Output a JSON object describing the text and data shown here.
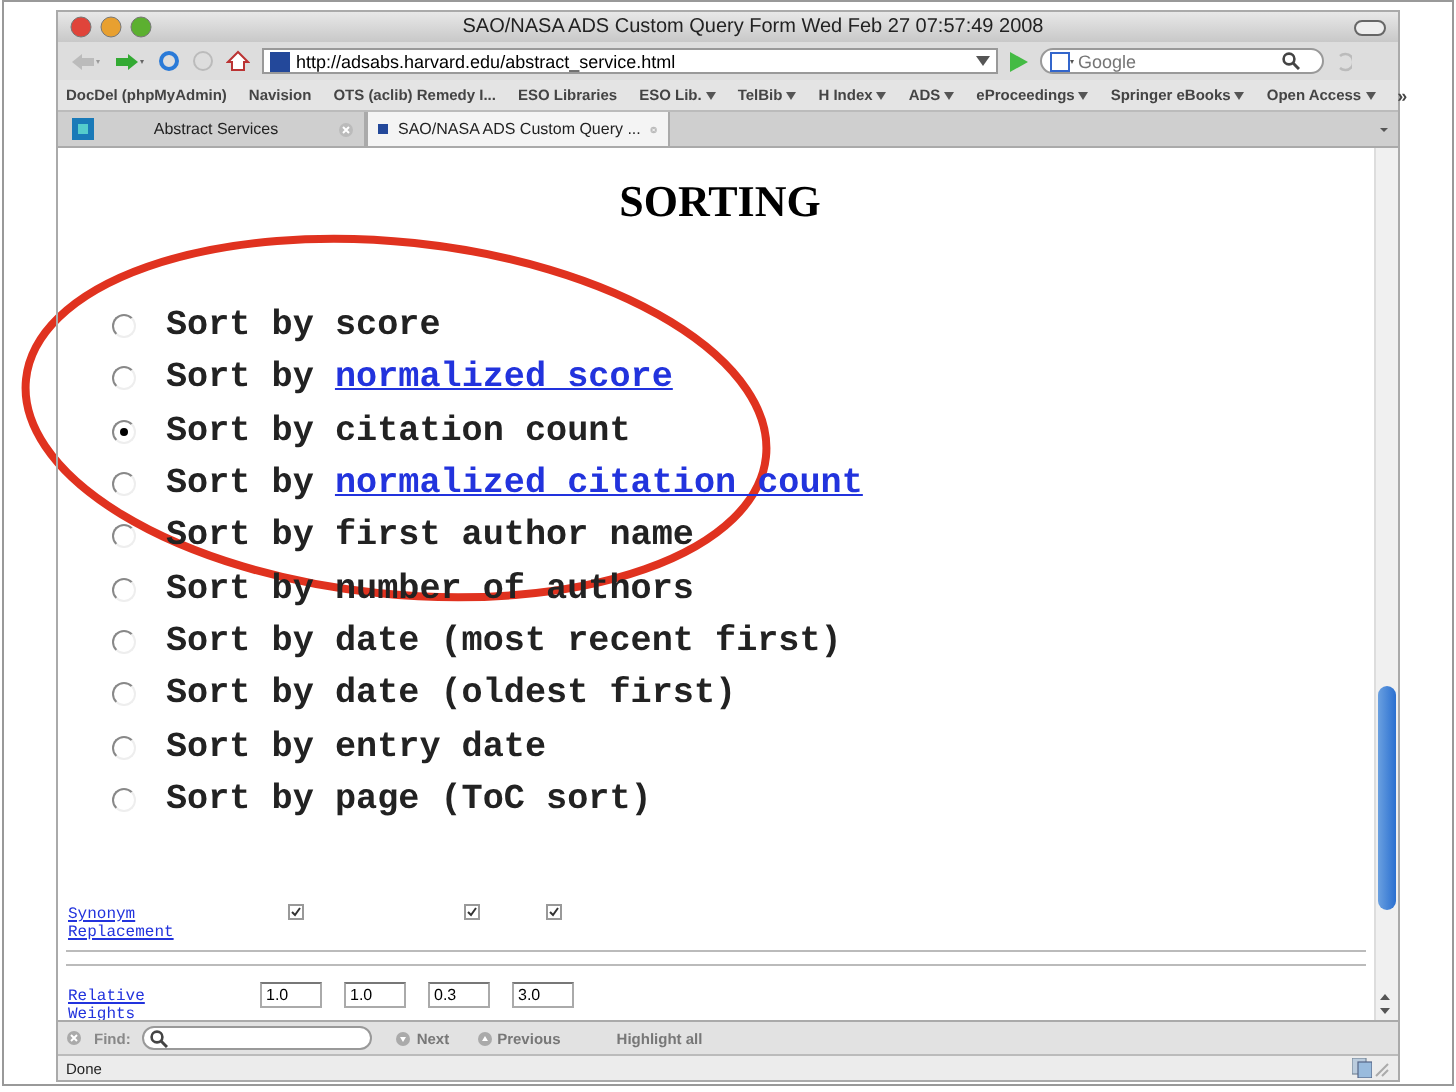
{
  "window": {
    "title": "SAO/NASA ADS Custom Query Form Wed Feb 27 07:57:49 2008"
  },
  "toolbar": {
    "url": "http://adsabs.harvard.edu/abstract_service.html",
    "search": {
      "placeholder": "Google"
    }
  },
  "bookmarks": [
    {
      "label": "DocDel (phpMyAdmin)",
      "menu": false
    },
    {
      "label": "Navision",
      "menu": false
    },
    {
      "label": "OTS (aclib) Remedy I...",
      "menu": false
    },
    {
      "label": "ESO Libraries",
      "menu": false
    },
    {
      "label": "ESO Lib.",
      "menu": true
    },
    {
      "label": "TelBib",
      "menu": true
    },
    {
      "label": "H Index",
      "menu": true
    },
    {
      "label": "ADS",
      "menu": true
    },
    {
      "label": "eProceedings",
      "menu": true
    },
    {
      "label": "Springer eBooks",
      "menu": true
    },
    {
      "label": "Open Access",
      "menu": true
    }
  ],
  "bookmarks_more": "»",
  "tabs": [
    {
      "label": "Abstract Services",
      "selected": false
    },
    {
      "label": "SAO/NASA ADS Custom Query ...",
      "selected": true
    }
  ],
  "page": {
    "heading": "SORTING",
    "sort_options": [
      {
        "text": "Sort by score",
        "selected": false
      },
      {
        "text": "Sort by",
        "link": "normalized score",
        "selected": false
      },
      {
        "text": "Sort by citation count",
        "selected": true
      },
      {
        "text": "Sort by",
        "link": "normalized citation count",
        "selected": false
      },
      {
        "text": "Sort by first author name",
        "selected": false
      },
      {
        "text": "Sort by number of authors",
        "selected": false
      },
      {
        "text": "Sort by date (most recent first)",
        "selected": false
      },
      {
        "text": "Sort by date (oldest first)",
        "selected": false
      },
      {
        "text": "Sort by entry date",
        "selected": false
      },
      {
        "text": "Sort by page (ToC sort)",
        "selected": false
      }
    ],
    "synonym": {
      "label": "Synonym Replacement",
      "checkboxes": [
        {
          "checked": true
        },
        {
          "checked": true
        },
        {
          "checked": true
        }
      ]
    },
    "weights": {
      "label": "Relative Weights",
      "values": [
        "1.0",
        "1.0",
        "0.3",
        "3.0"
      ]
    }
  },
  "find_bar": {
    "label": "Find:",
    "next": "Next",
    "previous": "Previous",
    "highlight": "Highlight all"
  },
  "status_bar": {
    "text": "Done"
  }
}
